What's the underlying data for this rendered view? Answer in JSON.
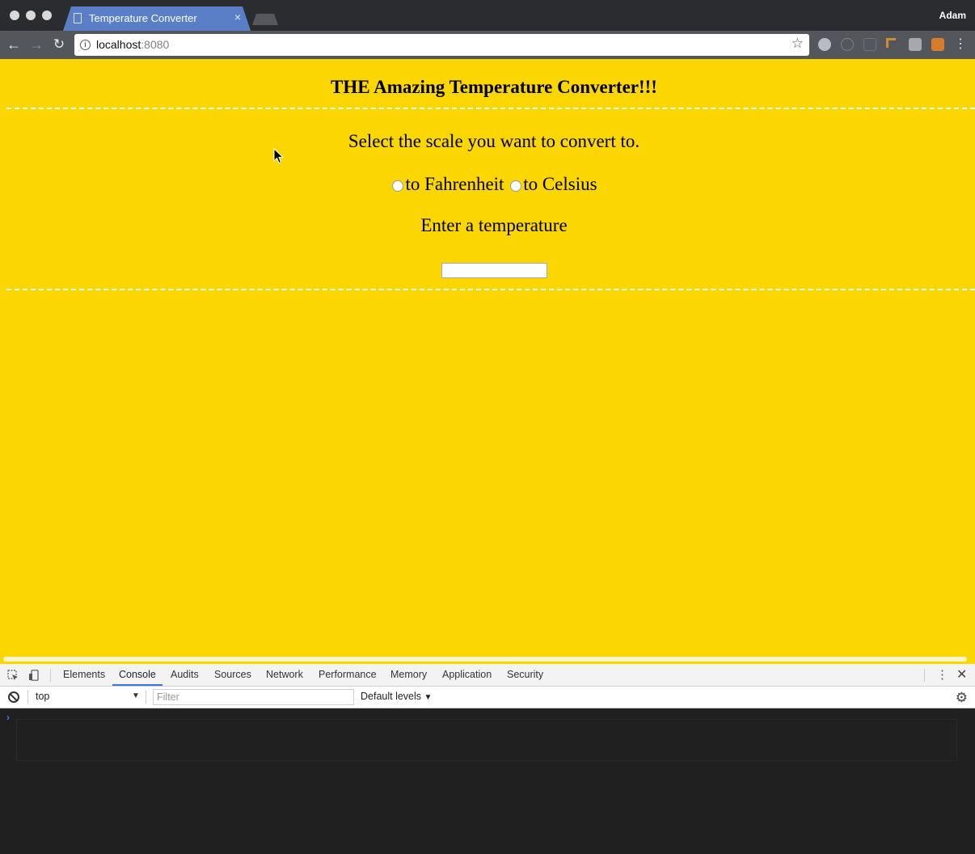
{
  "browser": {
    "tab_title": "Temperature Converter",
    "tab_close": "×",
    "profile_name": "Adam",
    "url_host": "localhost",
    "url_port": ":8080"
  },
  "page": {
    "heading": "THE Amazing Temperature Converter!!!",
    "scale_prompt": "Select the scale you want to convert to.",
    "options": [
      {
        "label": "to Fahrenheit"
      },
      {
        "label": "to Celsius"
      }
    ],
    "temperature_prompt": "Enter a temperature",
    "temperature_value": "",
    "background_color": "#fbd600"
  },
  "devtools": {
    "tabs": [
      "Elements",
      "Console",
      "Audits",
      "Sources",
      "Network",
      "Performance",
      "Memory",
      "Application",
      "Security"
    ],
    "active_tab": "Console",
    "context": "top",
    "filter_placeholder": "Filter",
    "levels": "Default levels"
  }
}
